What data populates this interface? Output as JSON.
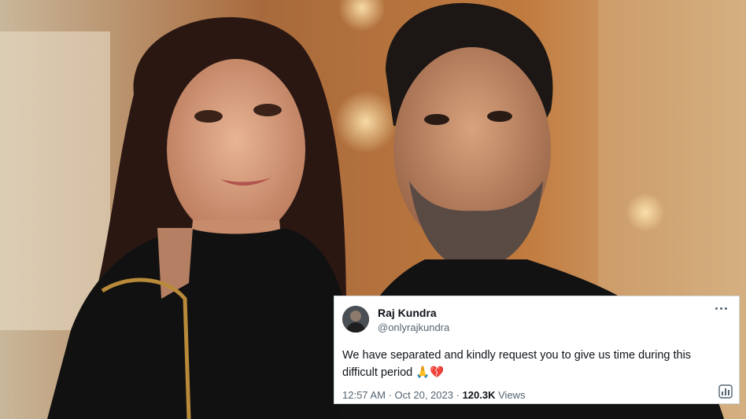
{
  "tweet": {
    "author_name": "Raj Kundra",
    "author_handle": "@onlyrajkundra",
    "text": "We have separated and kindly request you to give us time during this difficult period",
    "emojis": "🙏💔",
    "time": "12:57 AM",
    "separator": "·",
    "date": "Oct 20, 2023",
    "views_count": "120.3K",
    "views_label": "Views"
  },
  "icons": {
    "more": "more-options-icon",
    "analytics": "analytics-icon",
    "avatar": "avatar"
  },
  "colors": {
    "card_bg": "#ffffff",
    "text_primary": "#0f1419",
    "text_secondary": "#536471",
    "border": "#cfd9de"
  }
}
